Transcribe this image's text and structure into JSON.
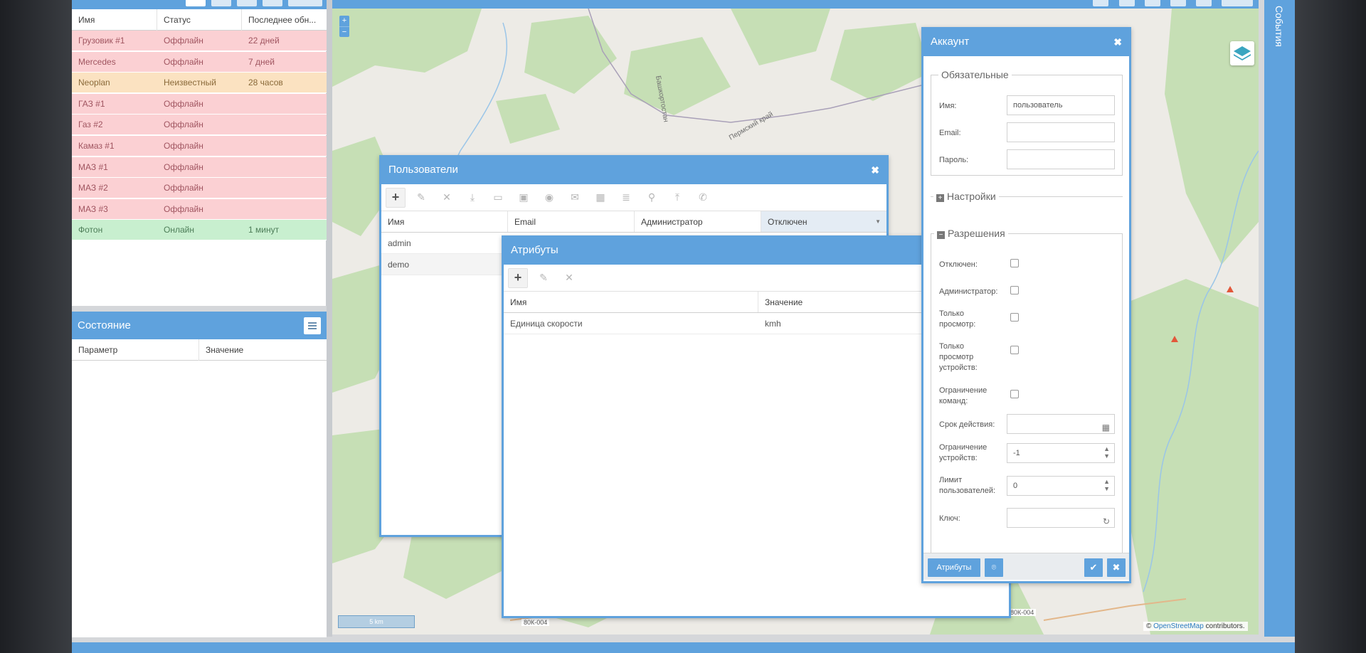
{
  "devices": {
    "columns": [
      "Имя",
      "Статус",
      "Последнее обн..."
    ],
    "rows": [
      {
        "name": "Грузовик #1",
        "status": "Оффлайн",
        "last": "22 дней",
        "state": "off"
      },
      {
        "name": "Mercedes",
        "status": "Оффлайн",
        "last": "7 дней",
        "state": "off"
      },
      {
        "name": "Neoplan",
        "status": "Неизвестный",
        "last": "28 часов",
        "state": "unk"
      },
      {
        "name": "ГАЗ #1",
        "status": "Оффлайн",
        "last": "",
        "state": "off"
      },
      {
        "name": "Газ #2",
        "status": "Оффлайн",
        "last": "",
        "state": "off"
      },
      {
        "name": "Камаз #1",
        "status": "Оффлайн",
        "last": "",
        "state": "off"
      },
      {
        "name": "МАЗ #1",
        "status": "Оффлайн",
        "last": "",
        "state": "off"
      },
      {
        "name": "МАЗ #2",
        "status": "Оффлайн",
        "last": "",
        "state": "off"
      },
      {
        "name": "МАЗ #3",
        "status": "Оффлайн",
        "last": "",
        "state": "off"
      },
      {
        "name": "Фотон",
        "status": "Онлайн",
        "last": "1 минут",
        "state": "on"
      }
    ]
  },
  "state": {
    "title": "Состояние",
    "columns": [
      "Параметр",
      "Значение"
    ]
  },
  "map": {
    "zoom_in": "+",
    "zoom_out": "−",
    "scale": "5 km",
    "road1": "80К-004",
    "road2": "80К-004",
    "attribution_prefix": "© ",
    "attribution_link": "OpenStreetMap",
    "attribution_suffix": " contributors.",
    "place1": "Башкортостан",
    "place2": "Пермский край"
  },
  "events_label": "События",
  "users_window": {
    "title": "Пользователи",
    "close": "✖",
    "columns": [
      "Имя",
      "Email",
      "Администратор",
      "Отключен"
    ],
    "rows": [
      {
        "name": "admin"
      },
      {
        "name": "demo"
      }
    ]
  },
  "attributes_window": {
    "title": "Атрибуты",
    "columns": [
      "Имя",
      "Значение"
    ],
    "rows": [
      {
        "name": "Единица скорости",
        "value": "kmh"
      }
    ]
  },
  "account_window": {
    "title": "Аккаунт",
    "close": "✖",
    "section_required": "Обязательные",
    "section_settings": "Настройки",
    "section_permissions": "Разрешения",
    "name_label": "Имя:",
    "name_value": "пользователь",
    "email_label": "Email:",
    "email_value": "",
    "password_label": "Пароль:",
    "disabled_label": "Отключен:",
    "admin_label": "Администратор:",
    "readonly_label_1": "Только",
    "readonly_label_2": "просмотр:",
    "devreadonly_label_1": "Только",
    "devreadonly_label_2": "просмотр",
    "devreadonly_label_3": "устройств:",
    "limitcmd_label_1": "Ограничение",
    "limitcmd_label_2": "команд:",
    "expiry_label": "Срок действия:",
    "devlimit_label_1": "Ограничение",
    "devlimit_label_2": "устройств:",
    "devlimit_value": "-1",
    "userlimit_label_1": "Лимит",
    "userlimit_label_2": "пользователей:",
    "userlimit_value": "0",
    "token_label": "Ключ:",
    "attributes_button": "Атрибуты",
    "settings_plus": "+",
    "permissions_minus": "−"
  },
  "colors": {
    "accent": "#5fa2dd",
    "offline": "#fbd0d3",
    "unknown": "#fbe2c1",
    "online": "#c8efcf"
  }
}
